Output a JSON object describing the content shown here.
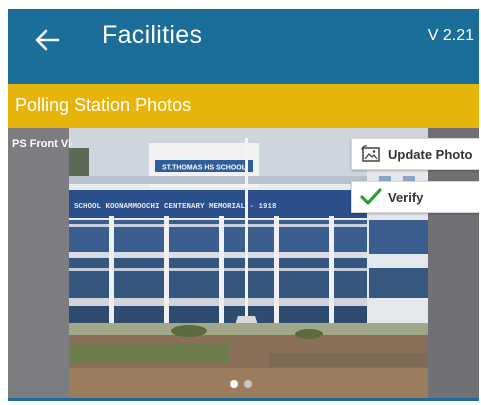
{
  "app_bar": {
    "title": "Facilities",
    "version": "V 2.21",
    "back_icon": "arrow-left-icon",
    "color": "#1b6e99"
  },
  "section": {
    "title": "Polling Station Photos",
    "color": "#e7b40c"
  },
  "photo_card": {
    "label": "PS Front View",
    "building_sign": "ST.THOMAS HS SCHOOL",
    "building_banner": "SCHOOL KOONAMMOOCHI CENTENARY MEMORIAL - 1918",
    "actions": [
      {
        "label": "Update Photo",
        "icon": "photo-update-icon"
      },
      {
        "label": "Verify",
        "icon": "checkmark-icon",
        "icon_color": "#2e9e3a"
      }
    ],
    "pagination": {
      "total": 2,
      "current": 1
    }
  }
}
